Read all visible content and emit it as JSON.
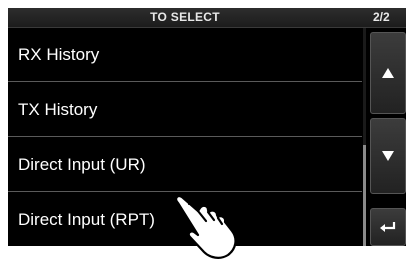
{
  "header": {
    "title": "TO SELECT",
    "page_indicator": "2/2"
  },
  "list": {
    "items": [
      {
        "label": "RX History"
      },
      {
        "label": "TX History"
      },
      {
        "label": "Direct Input (UR)"
      },
      {
        "label": "Direct Input (RPT)"
      }
    ]
  },
  "scrollbar": {
    "position_fraction": 0.54,
    "visible_fraction": 0.46
  },
  "buttons": {
    "up_icon": "triangle-up-icon",
    "down_icon": "triangle-down-icon",
    "back_icon": "return-arrow-icon"
  },
  "colors": {
    "background": "#000000",
    "text": "#ffffff",
    "divider": "#5a5a5a",
    "button": "#333333"
  }
}
